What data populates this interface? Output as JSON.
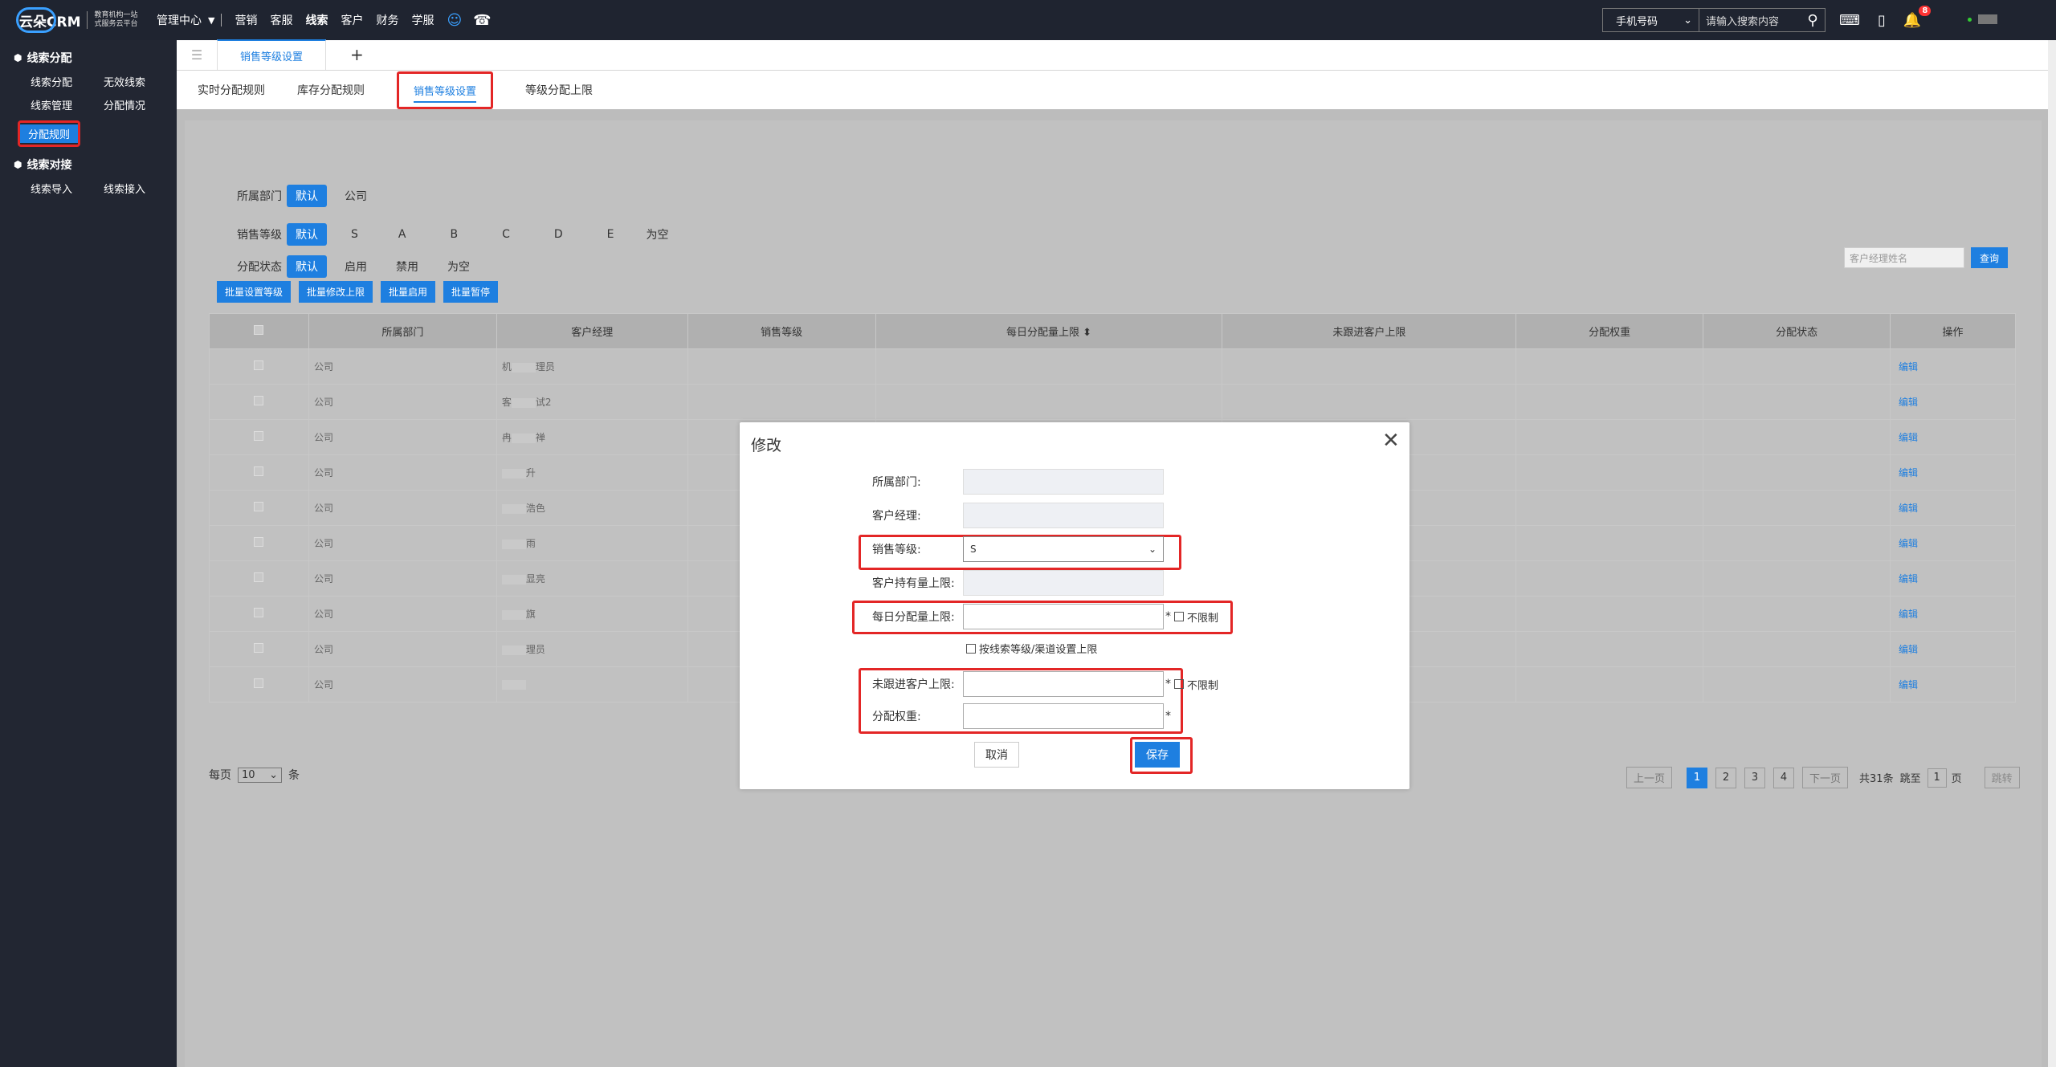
{
  "brand": {
    "name": "云朵CRM",
    "slogan1": "教育机构一站",
    "slogan2": "式服务云平台"
  },
  "topnav": {
    "mgmt": "管理中心",
    "items": [
      "营销",
      "客服",
      "线索",
      "客户",
      "财务",
      "学服"
    ],
    "active": "线索"
  },
  "search": {
    "select": "手机号码",
    "placeholder": "请输入搜索内容"
  },
  "notif_count": "8",
  "sidebar": {
    "group1": "线索分配",
    "row1": [
      "线索分配",
      "无效线索"
    ],
    "row2": [
      "线索管理",
      "分配情况"
    ],
    "active": "分配规则",
    "group2": "线索对接",
    "row3": [
      "线索导入",
      "线索接入"
    ]
  },
  "tabs1": {
    "active": "销售等级设置",
    "plus": "+"
  },
  "tabs2": [
    "实时分配规则",
    "库存分配规则",
    "销售等级设置",
    "等级分配上限"
  ],
  "filters": {
    "dept": {
      "label": "所属部门",
      "default": "默认",
      "options": [
        "公司"
      ]
    },
    "level": {
      "label": "销售等级",
      "default": "默认",
      "options": [
        "S",
        "A",
        "B",
        "C",
        "D",
        "E",
        "为空"
      ]
    },
    "status": {
      "label": "分配状态",
      "default": "默认",
      "options": [
        "启用",
        "禁用",
        "为空"
      ]
    }
  },
  "query": {
    "placeholder": "客户经理姓名",
    "button": "查询"
  },
  "batch": [
    "批量设置等级",
    "批量修改上限",
    "批量启用",
    "批量暂停"
  ],
  "table": {
    "headers": [
      "所属部门",
      "客户经理",
      "销售等级",
      "每日分配量上限",
      "未跟进客户上限",
      "分配权重",
      "分配状态",
      "操作"
    ],
    "sort_icon": "⬍",
    "rows": [
      {
        "dept": "公司",
        "mgr_a": "机",
        "mgr_b": "理员"
      },
      {
        "dept": "公司",
        "mgr_a": "客",
        "mgr_b": "试2"
      },
      {
        "dept": "公司",
        "mgr_a": "冉",
        "mgr_b": "禅"
      },
      {
        "dept": "公司",
        "mgr_a": "",
        "mgr_b": "升"
      },
      {
        "dept": "公司",
        "mgr_a": "",
        "mgr_b": "浩色"
      },
      {
        "dept": "公司",
        "mgr_a": "",
        "mgr_b": "雨"
      },
      {
        "dept": "公司",
        "mgr_a": "",
        "mgr_b": "显亮"
      },
      {
        "dept": "公司",
        "mgr_a": "",
        "mgr_b": "旗"
      },
      {
        "dept": "公司",
        "mgr_a": "",
        "mgr_b": "理员"
      },
      {
        "dept": "公司",
        "mgr_a": "",
        "mgr_b": ""
      }
    ],
    "edit": "编辑"
  },
  "pager": {
    "per_page": "每页",
    "size": "10",
    "unit": "条",
    "prev": "上一页",
    "pages": [
      "1",
      "2",
      "3",
      "4"
    ],
    "next": "下一页",
    "total": "共31条",
    "goto": "跳至",
    "goto_val": "1",
    "page_unit": "页",
    "jump": "跳转"
  },
  "modal": {
    "title": "修改",
    "close": "✕",
    "dept_label": "所属部门:",
    "mgr_label": "客户经理:",
    "level_label": "销售等级:",
    "level_value": "S",
    "hold_label": "客户持有量上限:",
    "daily_label": "每日分配量上限:",
    "unlimited": "不限制",
    "by_level": "按线索等级/渠道设置上限",
    "unfollow_label": "未跟进客户上限:",
    "weight_label": "分配权重:",
    "star": "*",
    "cancel": "取消",
    "save": "保存"
  },
  "colors": {
    "accent": "#1e7fe0",
    "highlight": "#e32626",
    "dark": "#1f2430"
  }
}
